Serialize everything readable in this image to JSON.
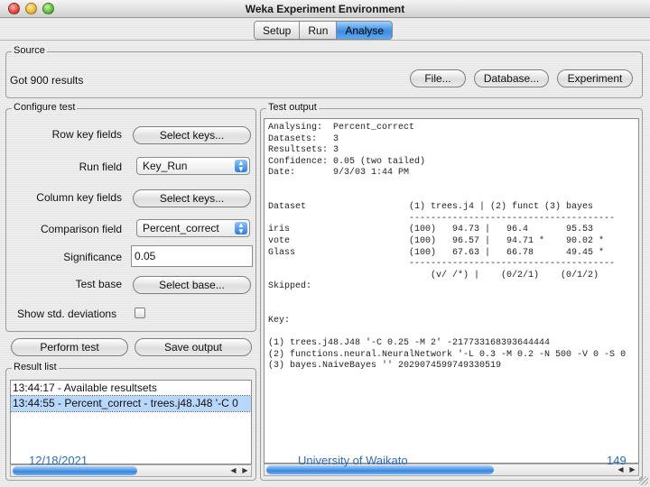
{
  "window": {
    "title": "Weka Experiment Environment"
  },
  "tabs": [
    {
      "label": "Setup",
      "active": false
    },
    {
      "label": "Run",
      "active": false
    },
    {
      "label": "Analyse",
      "active": true
    }
  ],
  "source": {
    "legend": "Source",
    "status": "Got 900 results",
    "file_button": "File...",
    "database_button": "Database...",
    "experiment_button": "Experiment"
  },
  "configure": {
    "legend": "Configure test",
    "row_key_label": "Row key fields",
    "row_key_button": "Select keys...",
    "run_field_label": "Run field",
    "run_field_value": "Key_Run",
    "column_key_label": "Column key fields",
    "column_key_button": "Select keys...",
    "comparison_label": "Comparison field",
    "comparison_value": "Percent_correct",
    "significance_label": "Significance",
    "significance_value": "0.05",
    "test_base_label": "Test base",
    "test_base_button": "Select base...",
    "std_dev_label": "Show std. deviations",
    "std_dev_checked": false
  },
  "actions": {
    "perform_test": "Perform test",
    "save_output": "Save output"
  },
  "result_list": {
    "legend": "Result list",
    "items": [
      {
        "text": "13:44:17 - Available resultsets",
        "selected": false
      },
      {
        "text": "13:44:55 - Percent_correct - trees.j48.J48 '-C 0",
        "selected": true
      }
    ]
  },
  "test_output": {
    "legend": "Test output",
    "text": "Analysing:  Percent_correct\nDatasets:   3\nResultsets: 3\nConfidence: 0.05 (two tailed)\nDate:       9/3/03 1:44 PM\n\n\nDataset                   (1) trees.j4 | (2) funct (3) bayes\n                          --------------------------------------\niris                      (100)   94.73 |   96.4       95.53\nvote                      (100)   96.57 |   94.71 *    90.02 *\nGlass                     (100)   67.63 |   66.78      49.45 *\n                          --------------------------------------\n                              (v/ /*) |    (0/2/1)    (0/1/2)\nSkipped:\n\n\nKey:\n\n(1) trees.j48.J48 '-C 0.25 -M 2' -217733168393644444\n(2) functions.neural.NeuralNetwork '-L 0.3 -M 0.2 -N 500 -V 0 -S 0\n(3) bayes.NaiveBayes '' 2029074599749330519"
  },
  "footer": {
    "date": "12/18/2021",
    "org": "University of Waikato",
    "page": "149"
  },
  "colors": {
    "accent": "#3d8de0",
    "footer_text": "#2a6acb"
  }
}
